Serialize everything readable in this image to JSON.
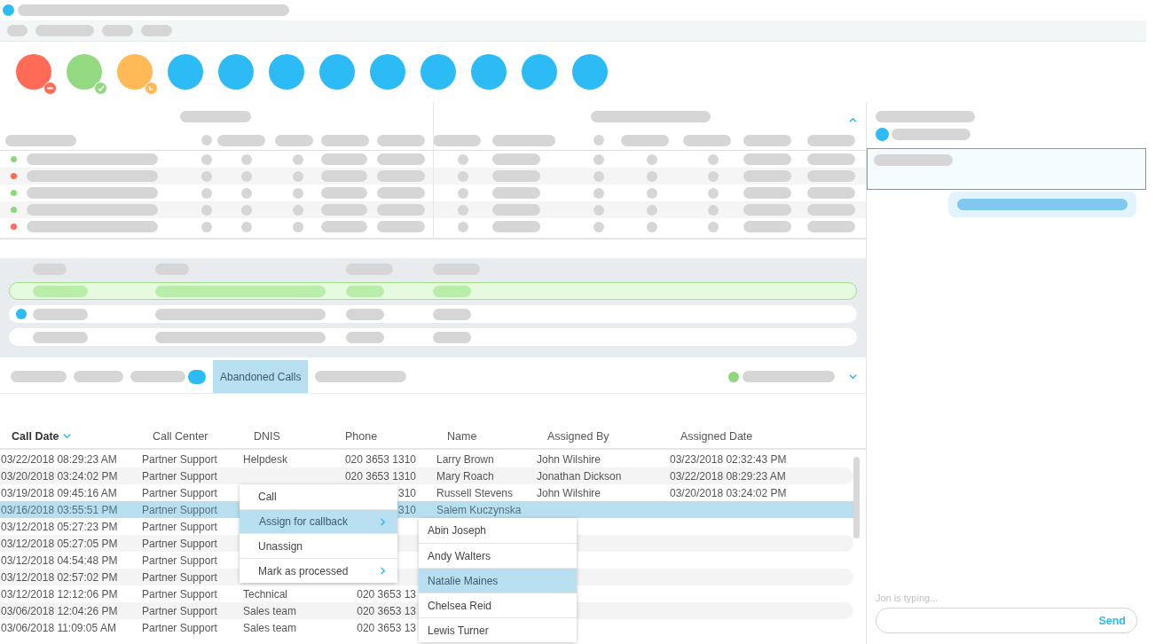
{
  "avatars": [
    {
      "color": "#ff6b57",
      "kind": "busy"
    },
    {
      "color": "#92d982",
      "kind": "available"
    },
    {
      "color": "#ffb957",
      "kind": "away"
    },
    {
      "color": "#2dbbf5",
      "kind": "plain"
    },
    {
      "color": "#2dbbf5",
      "kind": "plain"
    },
    {
      "color": "#2dbbf5",
      "kind": "plain"
    },
    {
      "color": "#2dbbf5",
      "kind": "plain"
    },
    {
      "color": "#2dbbf5",
      "kind": "plain"
    },
    {
      "color": "#2dbbf5",
      "kind": "plain"
    },
    {
      "color": "#2dbbf5",
      "kind": "plain"
    },
    {
      "color": "#2dbbf5",
      "kind": "plain"
    },
    {
      "color": "#2dbbf5",
      "kind": "plain"
    }
  ],
  "agent_rows": [
    {
      "color": "#8ed87a"
    },
    {
      "color": "#ff6b57"
    },
    {
      "color": "#8ed87a"
    },
    {
      "color": "#8ed87a"
    },
    {
      "color": "#ff6b57"
    }
  ],
  "queue_rows": [
    {
      "selected": true,
      "dot": false
    },
    {
      "selected": false,
      "dot": true
    },
    {
      "selected": false,
      "dot": false
    }
  ],
  "tabs": [
    {
      "selected": false,
      "badge": false
    },
    {
      "selected": false,
      "badge": false
    },
    {
      "selected": false,
      "badge": true
    },
    {
      "label": "Abandoned Calls",
      "selected": true,
      "badge": false
    },
    {
      "selected": false,
      "badge": false
    }
  ],
  "table": {
    "columns": [
      {
        "label": "Call Date",
        "sorted": true
      },
      {
        "label": "Call Center",
        "sorted": false
      },
      {
        "label": "DNIS",
        "sorted": false
      },
      {
        "label": "Phone",
        "sorted": false
      },
      {
        "label": "Name",
        "sorted": false
      },
      {
        "label": "Assigned By",
        "sorted": false
      },
      {
        "label": "Assigned Date",
        "sorted": false
      }
    ],
    "rows": [
      {
        "selected": false,
        "cells": [
          "03/22/2018 08:29:23 AM",
          "Partner Support",
          "Helpdesk",
          "020 3653 1310",
          "Larry Brown",
          "John Wilshire",
          "03/23/2018 02:32:43 PM"
        ]
      },
      {
        "selected": false,
        "cells": [
          "03/20/2018 03:24:02 PM",
          "Partner Support",
          "",
          "020 3653 1310",
          "Mary Roach",
          "Jonathan Dickson",
          "03/22/2018 08:29:23 AM"
        ]
      },
      {
        "selected": false,
        "cells": [
          "03/19/2018 09:45:16 AM",
          "Partner Support",
          "",
          "310",
          "Russell Stevens",
          "John Wilshire",
          "03/20/2018 03:24:02 PM"
        ]
      },
      {
        "selected": true,
        "cells": [
          "03/16/2018 03:55:51 PM",
          "Partner Support",
          "",
          "310",
          "Salem Kuczynska",
          "",
          ""
        ]
      },
      {
        "selected": false,
        "cells": [
          "03/12/2018 05:27:23 PM",
          "Partner Support",
          "",
          "",
          "",
          "",
          ""
        ]
      },
      {
        "selected": false,
        "cells": [
          "03/12/2018 05:27:05 PM",
          "Partner Support",
          "",
          "",
          "",
          "",
          ""
        ]
      },
      {
        "selected": false,
        "cells": [
          "03/12/2018 04:54:48 PM",
          "Partner Support",
          "",
          "",
          "",
          "",
          ""
        ]
      },
      {
        "selected": false,
        "cells": [
          "03/12/2018 02:57:02 PM",
          "Partner Support",
          "",
          "",
          "",
          "",
          ""
        ]
      },
      {
        "selected": false,
        "cells": [
          "03/12/2018 12:12:06 PM",
          "Partner Support",
          "Technical",
          "020 3653 13",
          "",
          "",
          ""
        ]
      },
      {
        "selected": false,
        "cells": [
          "03/06/2018 12:04:26 PM",
          "Partner Support",
          "Sales team",
          "020 3653 13",
          "",
          "",
          ""
        ]
      },
      {
        "selected": false,
        "cells": [
          "03/06/2018 11:09:05 AM",
          "Partner Support",
          "Sales team",
          "020 3653 13",
          "",
          "",
          ""
        ]
      }
    ]
  },
  "context_menu": {
    "items": [
      {
        "label": "Call",
        "selected": false,
        "submenu": false
      },
      {
        "label": "Assign for callback",
        "selected": true,
        "submenu": true
      },
      {
        "label": "Unassign",
        "selected": false,
        "submenu": false
      },
      {
        "label": "Mark as processed",
        "selected": false,
        "submenu": true
      }
    ]
  },
  "submenu": {
    "items": [
      {
        "label": "Abin Joseph",
        "selected": false
      },
      {
        "label": "Andy Walters",
        "selected": false
      },
      {
        "label": "Natalie Maines",
        "selected": true
      },
      {
        "label": "Chelsea Reid",
        "selected": false
      },
      {
        "label": "Lewis Turner",
        "selected": false
      }
    ]
  },
  "chat": {
    "typing": "Jon is typing...",
    "send": "Send"
  }
}
